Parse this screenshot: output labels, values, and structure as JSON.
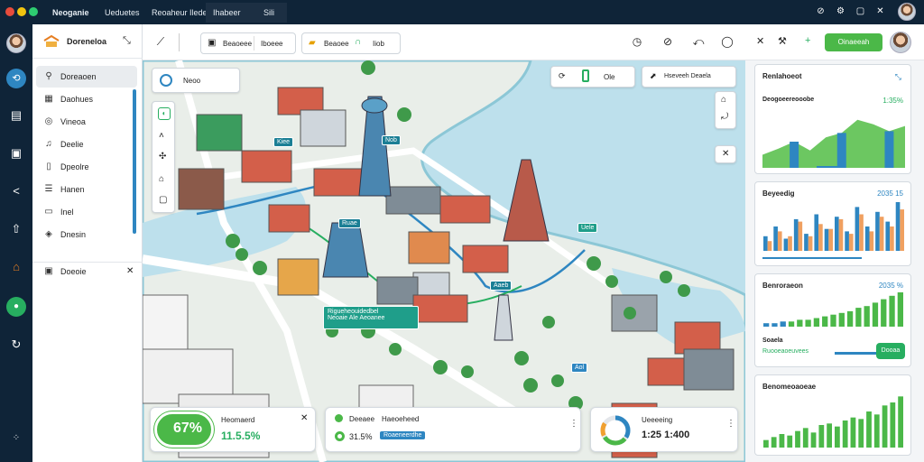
{
  "window": {
    "tabs": [
      "Neoganie",
      "Ueduetes",
      "Reoaheur Ilede",
      "Ihabeer",
      "Sili"
    ],
    "active_tab": 3
  },
  "sidebar": {
    "title": "Doreneloa",
    "items": [
      {
        "icon": "search-icon",
        "label": "Doreaoen"
      },
      {
        "icon": "grid-icon",
        "label": "Daohues"
      },
      {
        "icon": "globe-icon",
        "label": "Vineoa"
      },
      {
        "icon": "bell-icon",
        "label": "Deelie"
      },
      {
        "icon": "document-icon",
        "label": "Dpeolre"
      },
      {
        "icon": "list-icon",
        "label": "Hanen"
      },
      {
        "icon": "clipboard-icon",
        "label": "Inel"
      },
      {
        "icon": "layers-icon",
        "label": "Dnesin"
      }
    ],
    "footer_item": {
      "icon": "settings-icon",
      "label": "Doeoie"
    }
  },
  "toolbar": {
    "btn_a": "Beaoeee",
    "btn_b": "Iboeee",
    "btn_c": "Beaoee",
    "btn_d": "Iiob"
  },
  "map": {
    "search_label": "Neoo",
    "layer_btn": "Ole",
    "layer_menu": "Hseveeh Deaela",
    "callout_title": "Rigueheouidedbel",
    "callout_sub": "Neoaie Ale Aeoanee",
    "pins": [
      "Kiee",
      "Nob",
      "Uele",
      "Aaeb",
      "Ruae",
      "Aol"
    ]
  },
  "bottom_cards": {
    "left": {
      "value": "67%",
      "title": "Heomaerd",
      "metric": "11.5.5%"
    },
    "middle": {
      "row1_a": "Deeaee",
      "row1_b": "Haeoeheed",
      "row2_value": "31.5%",
      "row2_tag": "Roaeneerdhe"
    },
    "right": {
      "title": "Ueeeeing",
      "metric": "1:25 1:400"
    }
  },
  "rightbar": {
    "action_label": "Oinaeeah"
  },
  "right_cards": [
    {
      "title": "Renlahoeot",
      "subtitle": "Deogoeereooobe",
      "value": "1:35%"
    },
    {
      "title": "Beyeedig",
      "value": "2035 15"
    },
    {
      "title": "Benroraeon",
      "value": "2035 %"
    },
    {
      "title": "Benomeoaoeae",
      "value": ""
    }
  ],
  "slider_card": {
    "label1": "Soaela",
    "label2": "Ruooeaoeuvees",
    "button": "Dooaa"
  },
  "colors": {
    "accent": "#27ae60",
    "blue": "#2e86c1",
    "navy": "#0f2438",
    "water": "#bde0ec",
    "land": "#e9eee9"
  },
  "chart_data": [
    {
      "type": "area",
      "title": "Renlahoeot",
      "series": [
        {
          "values": [
            15,
            22,
            30,
            20,
            35,
            40,
            55,
            50,
            42,
            48
          ]
        }
      ]
    },
    {
      "type": "bar",
      "title": "Beyeedig",
      "series": [
        {
          "values": [
            6,
            10,
            5,
            13,
            7,
            15,
            9,
            14,
            8,
            18,
            10,
            16,
            12,
            20
          ]
        },
        {
          "values": [
            4,
            8,
            6,
            12,
            6,
            11,
            9,
            13,
            7,
            15,
            8,
            14,
            10,
            17
          ]
        }
      ]
    },
    {
      "type": "bar",
      "title": "Benroraeon",
      "series": [
        {
          "values": [
            2,
            2,
            3,
            3,
            4,
            4,
            5,
            6,
            7,
            8,
            9,
            11,
            12,
            14,
            16,
            18,
            20
          ]
        }
      ]
    },
    {
      "type": "bar",
      "title": "Benomeoaoeae",
      "series": [
        {
          "values": [
            5,
            7,
            9,
            8,
            11,
            13,
            10,
            15,
            16,
            14,
            18,
            20,
            19,
            24,
            22,
            28,
            30,
            34
          ]
        }
      ]
    }
  ]
}
